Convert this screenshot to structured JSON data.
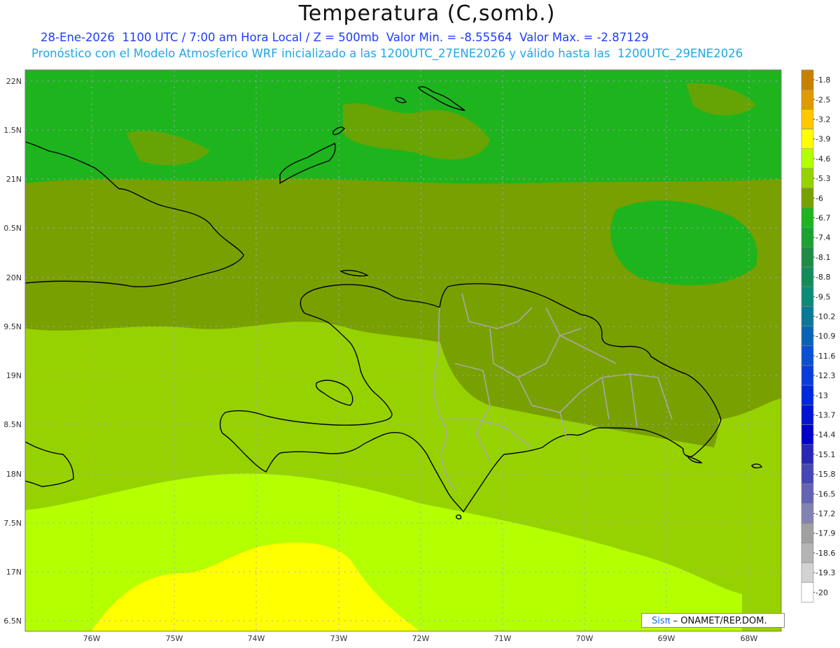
{
  "header": {
    "title": "Temperatura (C,somb.)",
    "subtitle_line1": "28-Ene-2026  1100 UTC / 7:00 am Hora Local / Z = 500mb  Valor Min. = -8.55564  Valor Max. = -2.87129",
    "subtitle_line2": "Pronóstico con el Modelo Atmosferico WRF inicializado a las 1200UTC_27ENE2026 y válido hasta las  1200UTC_29ENE2026"
  },
  "map": {
    "lat_labels": [
      "22N",
      "1.5N",
      "21N",
      "0.5N",
      "20N",
      "9.5N",
      "19N",
      "8.5N",
      "18N",
      "7.5N",
      "17N",
      "6.5N"
    ],
    "lon_labels": [
      "76W",
      "75W",
      "74W",
      "73W",
      "72W",
      "71W",
      "70W",
      "69W",
      "68W"
    ],
    "grid": true
  },
  "colorbar": {
    "labels": [
      "-1.8",
      "-2.5",
      "-3.2",
      "-3.9",
      "-4.6",
      "-5.3",
      "-6",
      "-6.7",
      "-7.4",
      "-8.1",
      "-8.8",
      "-9.5",
      "-10.2",
      "-10.9",
      "-11.6",
      "-12.3",
      "-13",
      "-13.7",
      "-14.4",
      "-15.1",
      "-15.8",
      "-16.5",
      "-17.2",
      "-17.9",
      "-18.6",
      "-19.3",
      "-20"
    ],
    "colors": [
      "#c88000",
      "#e09a00",
      "#ffc800",
      "#ffff00",
      "#b4ff00",
      "#96d200",
      "#78a000",
      "#1eb41e",
      "#1ea032",
      "#1e8c46",
      "#148c5a",
      "#0a8c78",
      "#0a7896",
      "#0a64b4",
      "#0a50d2",
      "#0a3cdc",
      "#0028dc",
      "#0014d2",
      "#0000c8",
      "#2828b4",
      "#4646b4",
      "#6464b4",
      "#8282b4",
      "#a0a0a0",
      "#b4b4b4",
      "#d2d2d2",
      "#ffffff"
    ]
  },
  "credit": {
    "brand": "Sisπ",
    "org": "– ONAMET/REP.DOM."
  }
}
